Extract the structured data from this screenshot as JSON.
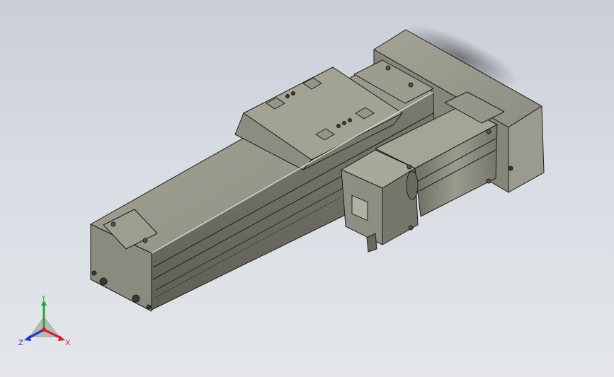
{
  "viewport": {
    "background_top": "#c9ced8",
    "background_bottom": "#e4e6ea"
  },
  "model": {
    "body_color": "#8b8b7f",
    "body_dark": "#5e5e55",
    "body_light": "#a9a99c",
    "edge_color": "#1e1e1a"
  },
  "triad": {
    "x_label": "X",
    "y_label": "Y",
    "z_label": "Z",
    "x_color": "#d0202a",
    "y_color": "#1ea83a",
    "z_color": "#2233cc"
  }
}
